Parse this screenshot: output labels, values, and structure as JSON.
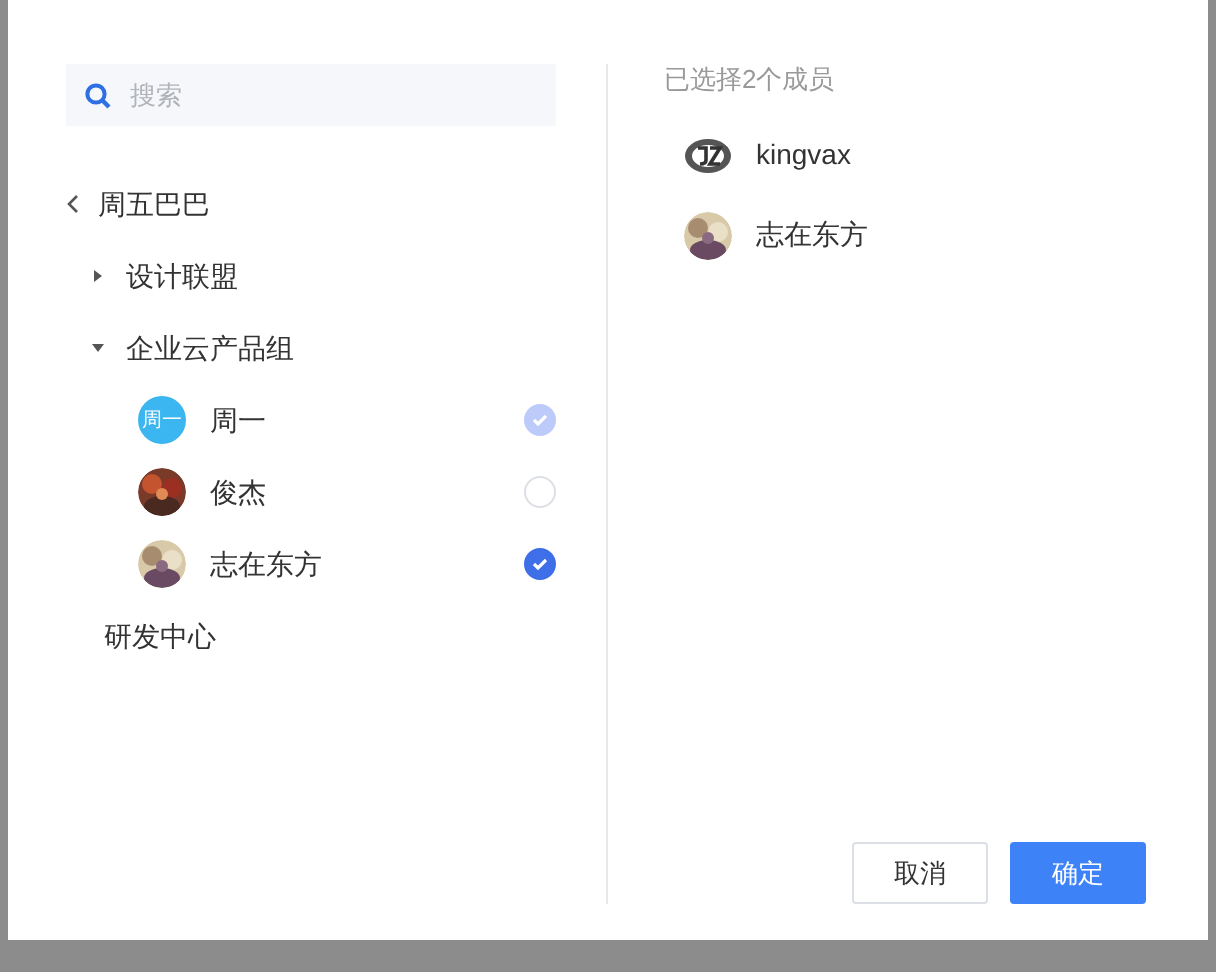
{
  "search": {
    "placeholder": "搜索"
  },
  "breadcrumb": {
    "label": "周五巴巴"
  },
  "tree": [
    {
      "label": "设计联盟",
      "expanded": false
    },
    {
      "label": "企业云产品组",
      "expanded": true,
      "children": [
        {
          "name": "周一",
          "avatar": {
            "kind": "initials",
            "text": "周一"
          },
          "checked": true,
          "disabled": true
        },
        {
          "name": "俊杰",
          "checked": false,
          "disabled": false
        },
        {
          "name": "志在东方",
          "checked": true,
          "disabled": false
        }
      ]
    }
  ],
  "departments": [
    "研发中心"
  ],
  "selected_summary": "已选择2个成员",
  "selected_members": [
    {
      "name": "kingvax",
      "avatar": {
        "kind": "logo"
      }
    },
    {
      "name": "志在东方"
    }
  ],
  "buttons": [
    {
      "label": "取消",
      "kind": "secondary"
    },
    {
      "label": "确定",
      "kind": "primary"
    }
  ]
}
